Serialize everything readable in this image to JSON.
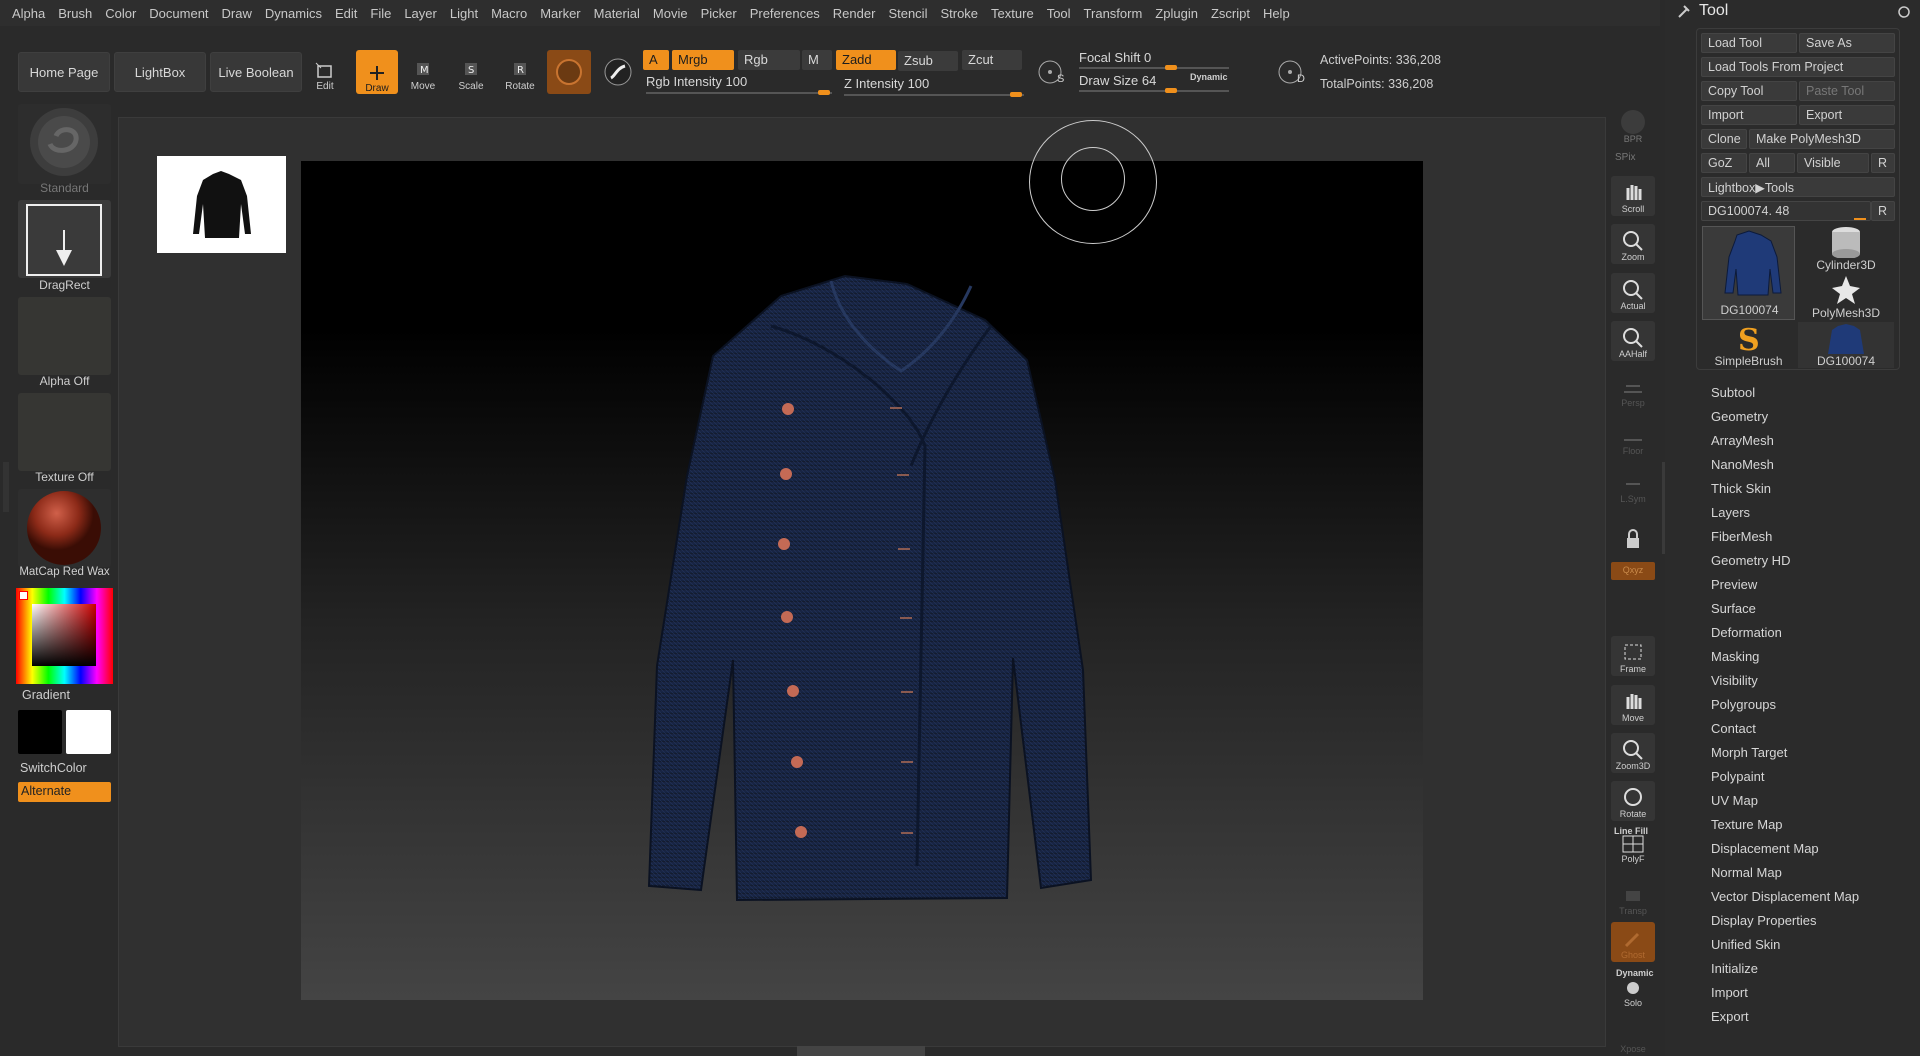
{
  "menu": [
    "Alpha",
    "Brush",
    "Color",
    "Document",
    "Draw",
    "Dynamics",
    "Edit",
    "File",
    "Layer",
    "Light",
    "Macro",
    "Marker",
    "Material",
    "Movie",
    "Picker",
    "Preferences",
    "Render",
    "Stencil",
    "Stroke",
    "Texture",
    "Tool",
    "Transform",
    "Zplugin",
    "Zscript",
    "Help"
  ],
  "toolbar": {
    "home": "Home Page",
    "lightbox": "LightBox",
    "live_boolean": "Live Boolean",
    "edit": "Edit",
    "draw": "Draw",
    "move": "Move",
    "scale": "Scale",
    "rotate": "Rotate",
    "a": "A",
    "mrgb": "Mrgb",
    "rgb": "Rgb",
    "m": "M",
    "zadd": "Zadd",
    "zsub": "Zsub",
    "zcut": "Zcut",
    "rgb_intensity": "Rgb Intensity 100",
    "z_intensity": "Z Intensity 100",
    "focal_shift": "Focal Shift 0",
    "draw_size": "Draw Size 64",
    "dynamic": "Dynamic",
    "s": "S",
    "d": "D",
    "active_points": "ActivePoints: 336,208",
    "total_points": "TotalPoints: 336,208"
  },
  "left": {
    "standard": "Standard",
    "dragrect": "DragRect",
    "alpha_off": "Alpha Off",
    "texture_off": "Texture Off",
    "matcap": "MatCap Red Wax",
    "gradient": "Gradient",
    "switchcolor": "SwitchColor",
    "alternate": "Alternate"
  },
  "right_shelf": [
    "BPR",
    "SPix",
    "Scroll",
    "Zoom",
    "Actual",
    "AAHalf",
    "Persp",
    "Floor",
    "L.Sym",
    "Qxyz",
    "Frame",
    "Move",
    "Zoom3D",
    "Rotate",
    "Line Fill",
    "PolyF",
    "Transp",
    "Ghost",
    "Dynamic",
    "Solo",
    "Xpose"
  ],
  "tool": {
    "title": "Tool",
    "load_tool": "Load Tool",
    "save_as": "Save As",
    "load_from_project": "Load Tools From Project",
    "copy_tool": "Copy Tool",
    "paste_tool": "Paste Tool",
    "import": "Import",
    "export": "Export",
    "clone": "Clone",
    "make_polymesh": "Make PolyMesh3D",
    "goz": "GoZ",
    "all": "All",
    "visible": "Visible",
    "r": "R",
    "lightbox_tools": "Lightbox▶Tools",
    "current": "DG100074. 48",
    "thumbs": [
      "DG100074",
      "Cylinder3D",
      "PolyMesh3D",
      "SimpleBrush",
      "DG100074"
    ],
    "sections": [
      "Subtool",
      "Geometry",
      "ArrayMesh",
      "NanoMesh",
      "Thick Skin",
      "Layers",
      "FiberMesh",
      "Geometry HD",
      "Preview",
      "Surface",
      "Deformation",
      "Masking",
      "Visibility",
      "Polygroups",
      "Contact",
      "Morph Target",
      "Polypaint",
      "UV Map",
      "Texture Map",
      "Displacement Map",
      "Normal Map",
      "Vector Displacement Map",
      "Display Properties",
      "Unified Skin",
      "Initialize",
      "Import",
      "Export"
    ]
  },
  "colors": {
    "accent": "#f0901c",
    "panel": "#2b2b2b",
    "jacket": "#1b2a4e"
  }
}
